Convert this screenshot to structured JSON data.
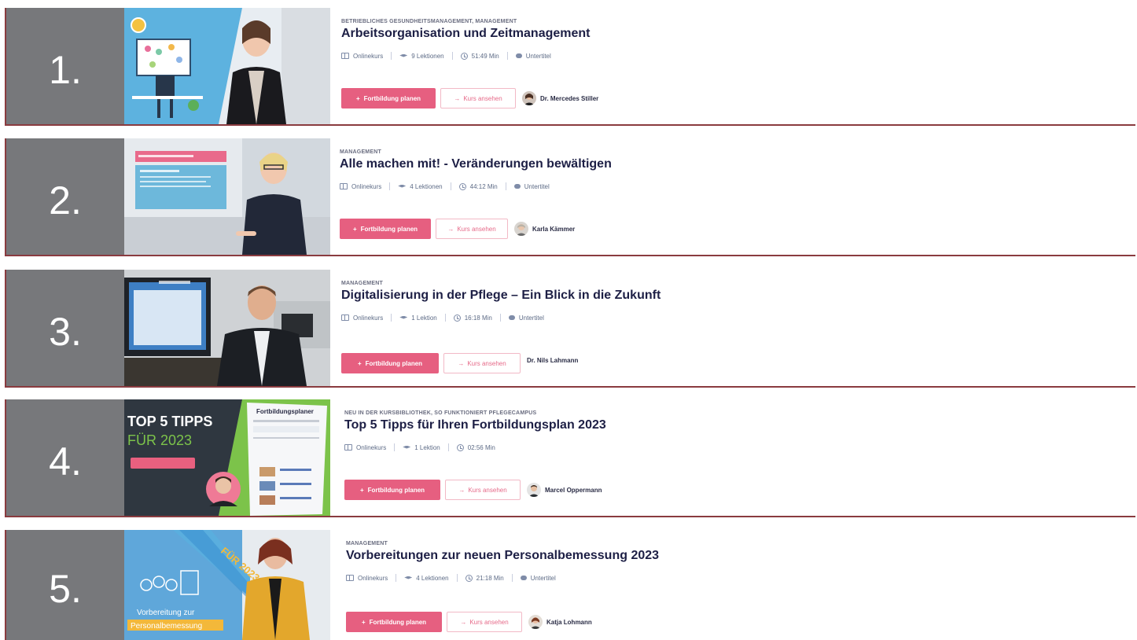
{
  "courses": [
    {
      "rank": "1.",
      "category": "Betriebliches Gesundheitsmanagement, Management",
      "title": "Arbeitsorganisation und Zeitmanagement",
      "type": "Onlinekurs",
      "lessons": "9 Lektionen",
      "duration": "51:49 Min",
      "subtitle": "Untertitel",
      "primary_label": "Fortbildung planen",
      "secondary_label": "Kurs ansehen",
      "author": "Dr. Mercedes Stiller"
    },
    {
      "rank": "2.",
      "category": "Management",
      "title": "Alle machen mit! - Veränderungen bewältigen",
      "type": "Onlinekurs",
      "lessons": "4 Lektionen",
      "duration": "44:12 Min",
      "subtitle": "Untertitel",
      "primary_label": "Fortbildung planen",
      "secondary_label": "Kurs ansehen",
      "author": "Karla Kämmer"
    },
    {
      "rank": "3.",
      "category": "Management",
      "title": "Digitalisierung in der Pflege – Ein Blick in die Zukunft",
      "type": "Onlinekurs",
      "lessons": "1 Lektion",
      "duration": "16:18 Min",
      "subtitle": "Untertitel",
      "primary_label": "Fortbildung planen",
      "secondary_label": "Kurs ansehen",
      "author": "Dr. Nils Lahmann"
    },
    {
      "rank": "4.",
      "category": "Neu in der Kursbibliothek, So funktioniert Pflegecampus",
      "title": "Top 5 Tipps für Ihren Fortbildungsplan 2023",
      "type": "Onlinekurs",
      "lessons": "1 Lektion",
      "duration": "02:56 Min",
      "primary_label": "Fortbildung planen",
      "secondary_label": "Kurs ansehen",
      "author": "Marcel Oppermann",
      "thumb_line1": "TOP 5 TIPPS",
      "thumb_line2": "FÜR 2023",
      "thumb_screen_title": "Fortbildungsplaner"
    },
    {
      "rank": "5.",
      "category": "Management",
      "title": "Vorbereitungen zur neuen Personalbemessung 2023",
      "type": "Onlinekurs",
      "lessons": "4 Lektionen",
      "duration": "21:18 Min",
      "subtitle": "Untertitel",
      "primary_label": "Fortbildung planen",
      "secondary_label": "Kurs ansehen",
      "author": "Katja Lohmann",
      "thumb_ribbon": "FÜR 2023",
      "thumb_caption1": "Vorbereitung zur",
      "thumb_caption2": "Personalbemessung"
    }
  ],
  "colors": {
    "rank_bg": "#77787b",
    "divider": "#8a3b3f",
    "primary": "#e65f80",
    "title": "#1d1f45"
  }
}
